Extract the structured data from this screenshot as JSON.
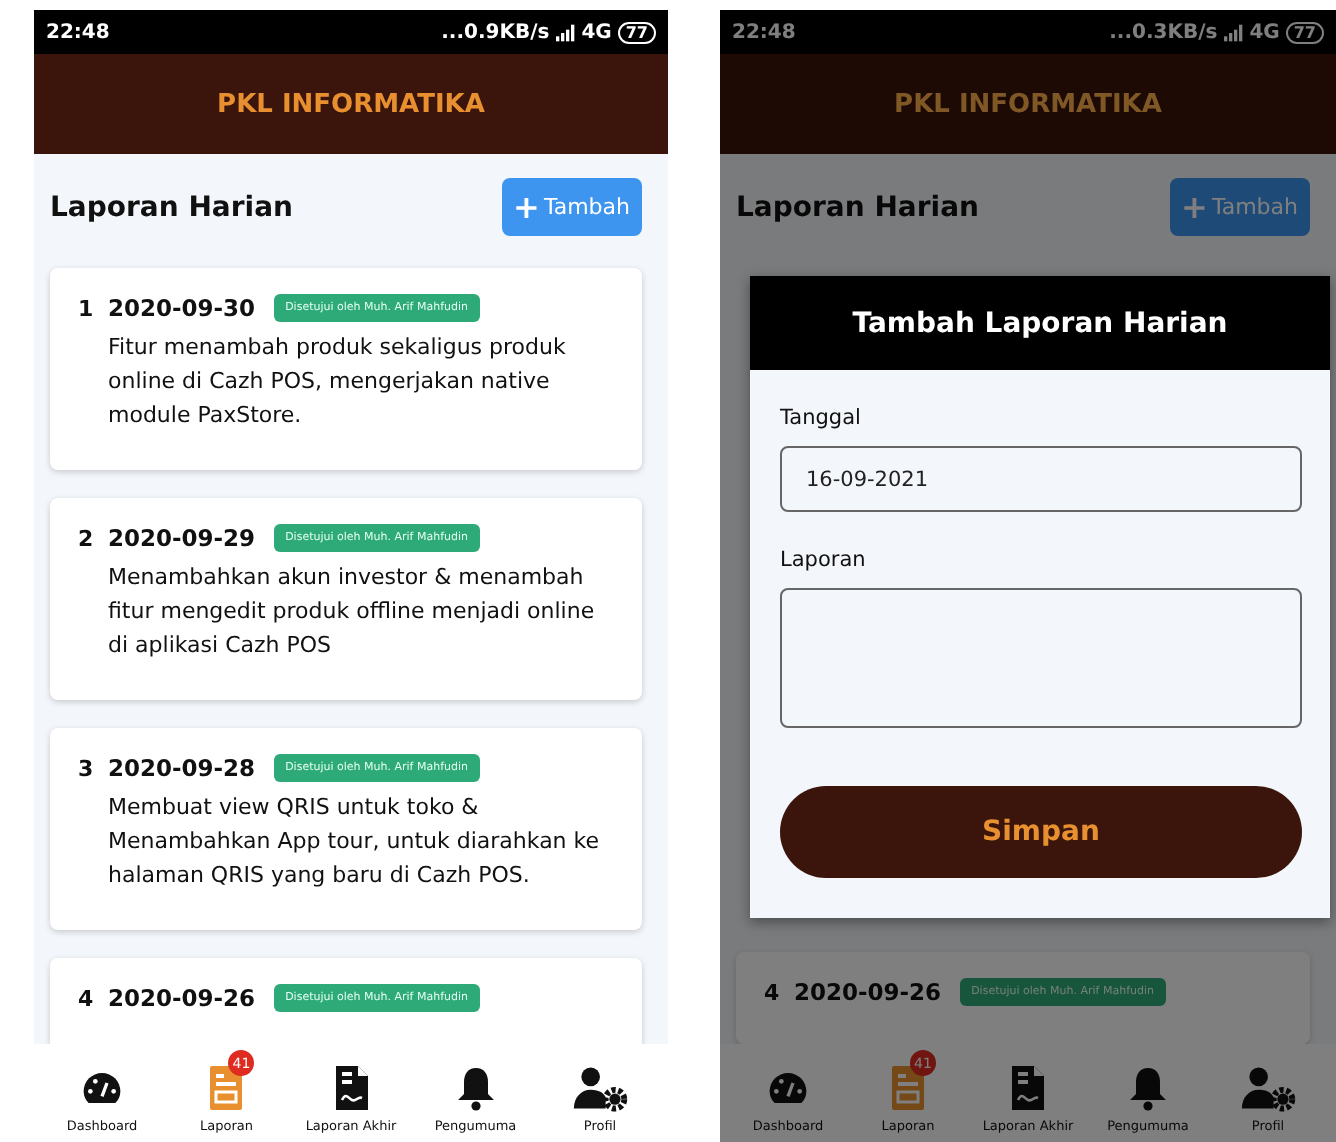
{
  "screens": [
    {
      "status_bar": {
        "time": "22:48",
        "network": "...0.9KB/s",
        "signal_type": "4G",
        "battery": "77"
      },
      "app_title": "PKL INFORMATIKA",
      "page_title": "Laporan Harian",
      "add_button": {
        "icon": "+",
        "label": "Tambah"
      },
      "reports": [
        {
          "number": "1",
          "date": "2020-09-30",
          "status": "Disetujui oleh Muh. Arif Mahfudin",
          "description": "Fitur menambah produk sekaligus produk online di Cazh POS, mengerjakan native module PaxStore."
        },
        {
          "number": "2",
          "date": "2020-09-29",
          "status": "Disetujui oleh Muh. Arif Mahfudin",
          "description": "Menambahkan akun investor & menambah fitur mengedit produk offline menjadi online di aplikasi Cazh POS"
        },
        {
          "number": "3",
          "date": "2020-09-28",
          "status": "Disetujui oleh Muh. Arif Mahfudin",
          "description": "Membuat view QRIS untuk toko & Menambahkan App tour, untuk diarahkan ke halaman QRIS yang baru di Cazh POS."
        },
        {
          "number": "4",
          "date": "2020-09-26",
          "status": "Disetujui oleh Muh. Arif Mahfudin"
        }
      ],
      "nav": [
        {
          "label": "Dashboard",
          "kind": "gauge",
          "selected": false
        },
        {
          "label": "Laporan",
          "kind": "document",
          "selected": true,
          "badge": "41"
        },
        {
          "label": "Laporan Akhir",
          "kind": "pdf",
          "selected": false
        },
        {
          "label": "Pengumuma",
          "kind": "bell",
          "selected": false
        },
        {
          "label": "Profil",
          "kind": "profile",
          "selected": false
        }
      ]
    },
    {
      "status_bar": {
        "time": "22:48",
        "network": "...0.3KB/s",
        "signal_type": "4G",
        "battery": "77"
      },
      "app_title": "PKL INFORMATIKA",
      "page_title": "Laporan Harian",
      "add_button": {
        "icon": "+",
        "label": "Tambah"
      },
      "reports": [
        {
          "number": "4",
          "date": "2020-09-26",
          "status": "Disetujui oleh Muh. Arif Mahfudin"
        }
      ],
      "nav": [
        {
          "label": "Dashboard",
          "kind": "gauge",
          "selected": false
        },
        {
          "label": "Laporan",
          "kind": "document",
          "selected": true,
          "badge": "41"
        },
        {
          "label": "Laporan Akhir",
          "kind": "pdf",
          "selected": false
        },
        {
          "label": "Pengumuma",
          "kind": "bell",
          "selected": false
        },
        {
          "label": "Profil",
          "kind": "profile",
          "selected": false
        }
      ],
      "dialog": {
        "title": "Tambah Laporan Harian",
        "date_label": "Tanggal",
        "date_value": "16-09-2021",
        "report_label": "Laporan",
        "save_button": "Simpan"
      }
    }
  ]
}
